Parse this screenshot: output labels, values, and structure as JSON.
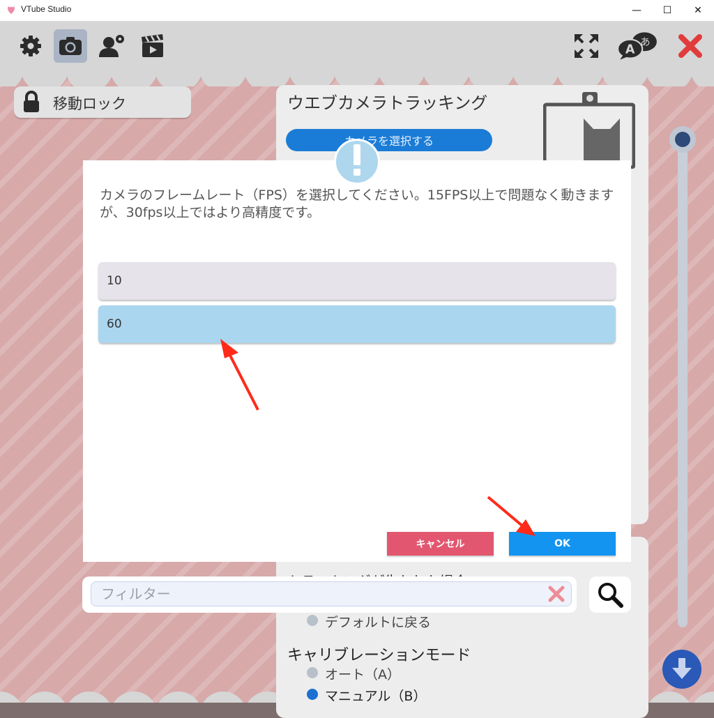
{
  "window": {
    "title": "VTube Studio",
    "minimize_glyph": "—",
    "maximize_glyph": "☐",
    "close_glyph": "✕"
  },
  "toolbar": {
    "left_icons": [
      "gear-icon",
      "camera-icon",
      "user-settings-icon",
      "clapperboard-icon"
    ],
    "right_icons": [
      "expand-icon",
      "language-icon",
      "close-app-icon"
    ]
  },
  "lock_button": {
    "label": "移動ロック"
  },
  "camera_panel": {
    "title": "ウエブカメラトラッキング",
    "select_camera_label": "カメラを選択する"
  },
  "lower_panel": {
    "tracking_lost_label": "トラッキングが失われた場合",
    "default_return_label": "デフォルトに戻る",
    "calibration_title": "キャリブレーションモード",
    "auto_label": "オート（A）",
    "manual_label": "マニュアル（B）"
  },
  "filter": {
    "placeholder": "フィルター",
    "value": ""
  },
  "dialog": {
    "message": "カメラのフレームレート（FPS）を選択してください。15FPS以上で問題なく動きますが、30fps以上ではより高精度です。",
    "options": [
      "10",
      "60"
    ],
    "selected_index": 1,
    "cancel_label": "キャンセル",
    "ok_label": "OK"
  },
  "colors": {
    "accent_blue": "#1394f0",
    "cancel_red": "#e2566f",
    "selected_option": "#abd6ef",
    "annotation_arrow": "#ff2a1a"
  }
}
